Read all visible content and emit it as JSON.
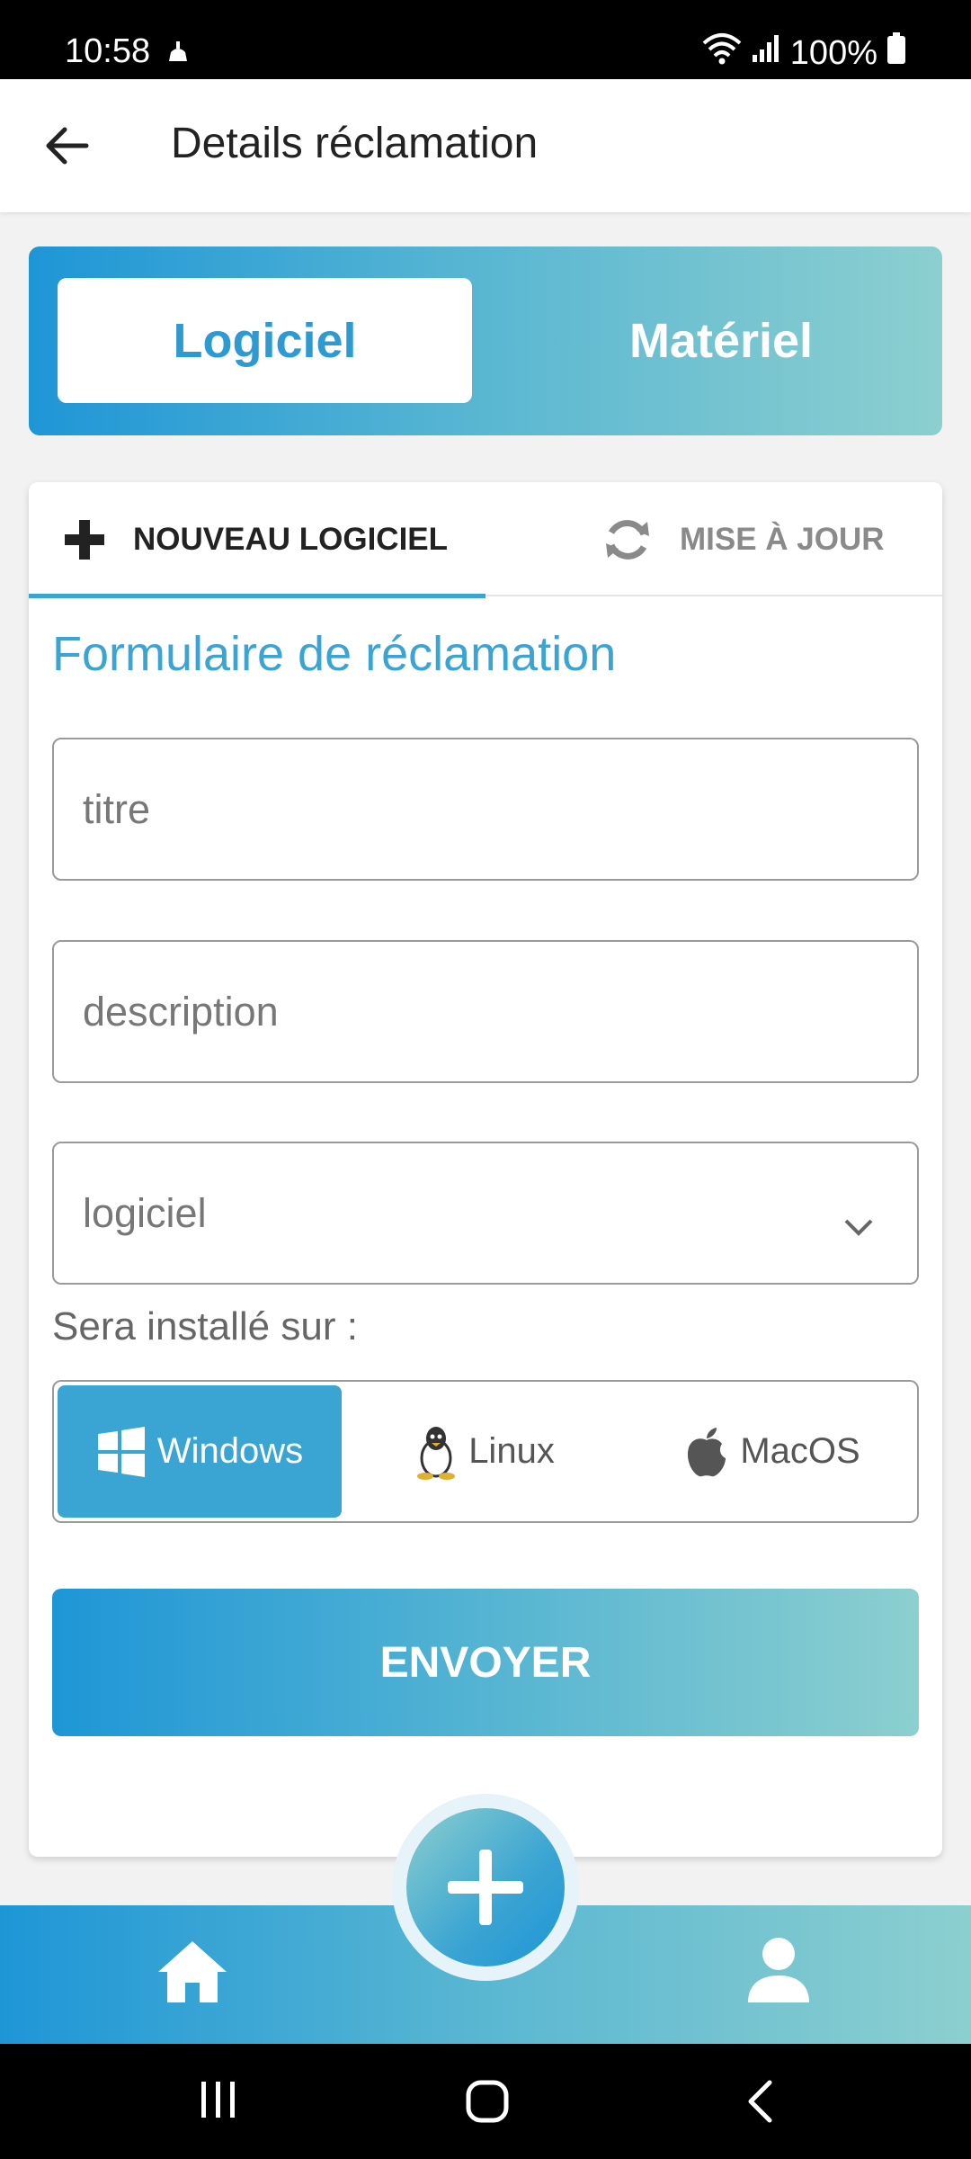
{
  "status_bar": {
    "time": "10:58",
    "battery": "100%"
  },
  "header": {
    "title": "Details réclamation"
  },
  "segment": {
    "active": "Logiciel",
    "other": "Matériel"
  },
  "tabs": [
    {
      "label": "NOUVEAU LOGICIEL",
      "icon": "plus-icon",
      "active": true
    },
    {
      "label": "MISE À JOUR",
      "icon": "refresh-icon",
      "active": false
    }
  ],
  "form": {
    "title": "Formulaire de réclamation",
    "title_placeholder": "titre",
    "description_placeholder": "description",
    "select_value": "logiciel",
    "install_label": "Sera installé sur :",
    "os_options": [
      "Windows",
      "Linux",
      "MacOS"
    ],
    "os_selected": "Windows",
    "submit_label": "ENVOYER"
  },
  "colors": {
    "accent": "#3aa4d2",
    "gradient_start": "#1e96d6",
    "gradient_end": "#8ccfcf"
  }
}
